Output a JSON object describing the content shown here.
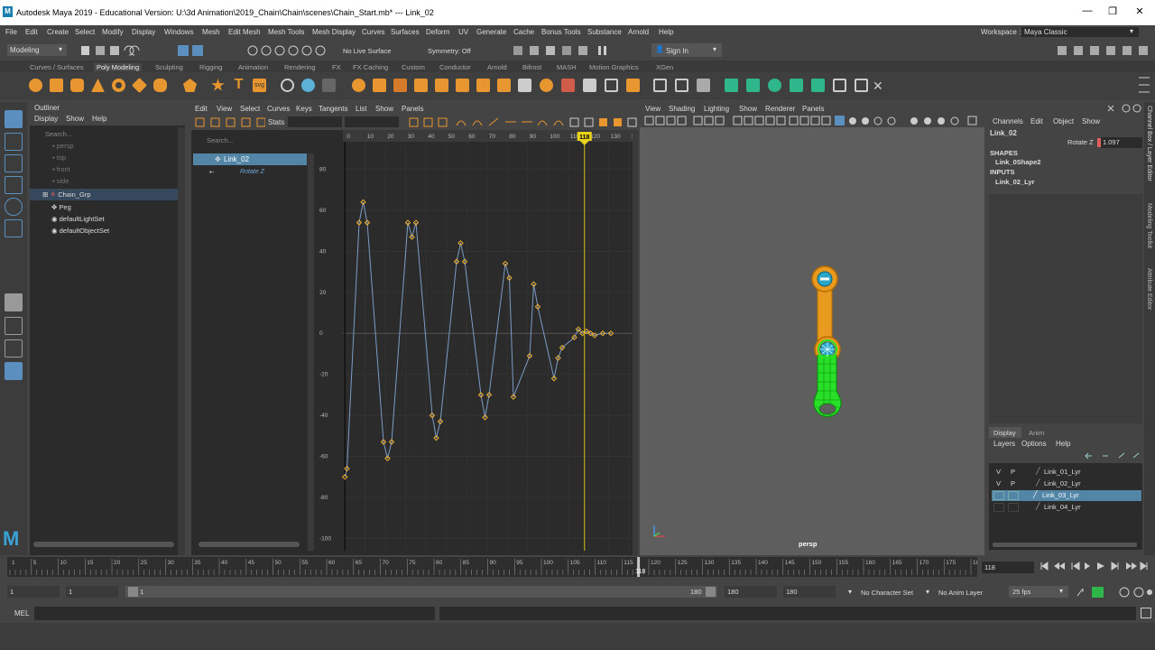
{
  "window": {
    "title": "Autodesk Maya 2019 - Educational Version: U:\\3d Animation\\2019_Chain\\Chain\\scenes\\Chain_Start.mb*  ---  Link_02",
    "logo": "M",
    "minimize": "—",
    "restore": "❐",
    "close": "✕"
  },
  "menu": {
    "items": [
      "File",
      "Edit",
      "Create",
      "Select",
      "Modify",
      "Display",
      "Windows",
      "Mesh",
      "Edit Mesh",
      "Mesh Tools",
      "Mesh Display",
      "Curves",
      "Surfaces",
      "Deform",
      "UV",
      "Generate",
      "Cache",
      "Bonus Tools",
      "Substance",
      "Arnold",
      "Help"
    ],
    "workspace_label": "Workspace :",
    "workspace_value": "Maya Classic"
  },
  "status": {
    "menuset": "Modeling",
    "live_surface": "No Live Surface",
    "symmetry": "Symmetry: Off",
    "sign_in": "Sign In"
  },
  "shelf": {
    "tabs": [
      "Curves / Surfaces",
      "Poly Modeling",
      "Sculpting",
      "Rigging",
      "Animation",
      "Rendering",
      "FX",
      "FX Caching",
      "Custom",
      "Conductor",
      "Arnold",
      "Bifrost",
      "MASH",
      "Motion Graphics",
      "XGen"
    ],
    "active": "Poly Modeling",
    "text_tool": "T",
    "svg_tool": "svg"
  },
  "outliner": {
    "title": "Outliner",
    "menus": [
      "Display",
      "Show",
      "Help"
    ],
    "search_placeholder": "Search...",
    "items": [
      {
        "label": "persp",
        "dim": true
      },
      {
        "label": "top",
        "dim": true
      },
      {
        "label": "front",
        "dim": true
      },
      {
        "label": "side",
        "dim": true
      },
      {
        "label": "Chain_Grp",
        "dim": false,
        "selected": true
      },
      {
        "label": "Peg",
        "dim": false
      },
      {
        "label": "defaultLightSet",
        "dim": false
      },
      {
        "label": "defaultObjectSet",
        "dim": false
      }
    ]
  },
  "graph_editor": {
    "menus": [
      "Edit",
      "View",
      "Select",
      "Curves",
      "Keys",
      "Tangents",
      "List",
      "Show",
      "Panels"
    ],
    "stats_label": "Stats",
    "search_placeholder": "Search...",
    "node": "Link_02",
    "attr": "Rotate Z",
    "current_frame": "118"
  },
  "chart_data": {
    "type": "line",
    "title": "",
    "xlabel": "",
    "ylabel": "",
    "x_ticks": [
      0,
      10,
      20,
      30,
      40,
      50,
      60,
      70,
      80,
      90,
      100,
      110,
      118,
      120,
      130,
      140
    ],
    "y_ticks": [
      80,
      60,
      40,
      20,
      0,
      -20,
      -40,
      -60,
      -80,
      -100
    ],
    "xlim": [
      -1,
      143
    ],
    "ylim": [
      -106,
      93
    ],
    "series": [
      {
        "x": [
          0,
          1,
          7,
          9,
          11,
          19,
          21,
          23,
          31,
          33,
          35,
          43,
          45,
          47,
          55,
          57,
          59,
          67,
          69,
          71,
          79,
          81,
          83,
          91,
          93,
          95,
          103,
          105,
          107,
          113,
          115,
          117,
          119,
          121,
          123,
          127,
          131
        ],
        "y": [
          -70,
          -66,
          54,
          64,
          54,
          -53,
          -61,
          -53,
          54,
          47,
          54,
          -40,
          -51,
          -43,
          35,
          44,
          35,
          -30,
          -41,
          -30,
          34,
          27,
          -31,
          -11,
          24,
          13,
          -22,
          -12,
          -7,
          -2,
          2,
          0,
          1,
          0,
          -1,
          0,
          0
        ]
      }
    ]
  },
  "viewport": {
    "menus": [
      "View",
      "Shading",
      "Lighting",
      "Show",
      "Renderer",
      "Panels"
    ],
    "camera": "persp"
  },
  "channel_box": {
    "menus": [
      "Channels",
      "Edit",
      "Object",
      "Show"
    ],
    "node": "Link_02",
    "attr_label": "Rotate Z",
    "attr_value": "1.097",
    "shapes_label": "SHAPES",
    "shape": "Link_0Shape2",
    "inputs_label": "INPUTS",
    "input": "Link_02_Lyr",
    "layer_tabs": [
      "Display",
      "Anim"
    ],
    "layer_menus": [
      "Layers",
      "Options",
      "Help"
    ],
    "layers": [
      {
        "v": "V",
        "p": "P",
        "name": "Link_01_Lyr",
        "selected": false
      },
      {
        "v": "V",
        "p": "P",
        "name": "Link_02_Lyr",
        "selected": false
      },
      {
        "v": "",
        "p": "",
        "name": "Link_03_Lyr",
        "selected": true
      },
      {
        "v": "",
        "p": "",
        "name": "Link_04_Lyr",
        "selected": false
      }
    ]
  },
  "side_tabs": [
    "Channel Box / Layer Editor",
    "Modeling Toolkit",
    "Attribute Editor"
  ],
  "timeline": {
    "ticks": [
      "1",
      "5",
      "10",
      "15",
      "20",
      "25",
      "30",
      "35",
      "40",
      "45",
      "50",
      "55",
      "60",
      "65",
      "70",
      "75",
      "80",
      "85",
      "90",
      "95",
      "100",
      "105",
      "110",
      "115",
      "120",
      "125",
      "130",
      "135",
      "140",
      "145",
      "150",
      "155",
      "160",
      "165",
      "170",
      "175",
      "180"
    ],
    "current": "118",
    "current_field": "118"
  },
  "range": {
    "start": "1",
    "start_inner": "1",
    "range_start": "1",
    "range_end": "180",
    "end": "180",
    "end2": "180",
    "character_set": "No Character Set",
    "anim_layer": "No Anim Layer",
    "fps": "25 fps"
  },
  "command": {
    "lang": "MEL"
  }
}
